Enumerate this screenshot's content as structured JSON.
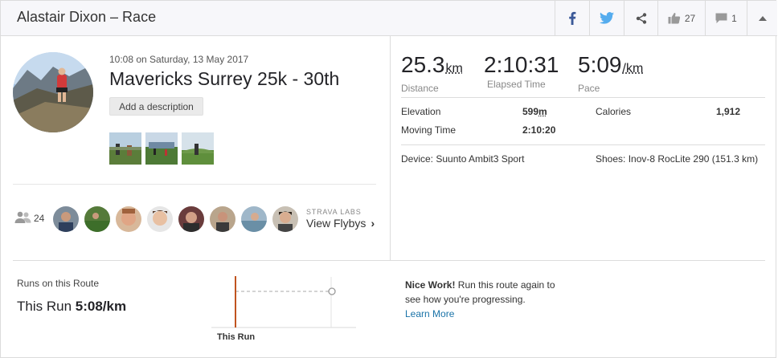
{
  "header": {
    "title": "Alastair Dixon – Race",
    "kudos_count": "27",
    "comments_count": "1"
  },
  "activity": {
    "datetime": "10:08 on Saturday, 13 May 2017",
    "name": "Mavericks Surrey 25k - 30th",
    "add_description": "Add a description"
  },
  "flybys": {
    "athlete_count": "24",
    "labs_label": "STRAVA LABS",
    "link_label": "View Flybys"
  },
  "stats": {
    "distance": {
      "value": "25.3",
      "unit": "km",
      "label": "Distance"
    },
    "elapsed": {
      "value": "2:10:31",
      "label": "Elapsed Time"
    },
    "pace": {
      "value": "5:09",
      "unit": "/km",
      "label": "Pace"
    },
    "elevation": {
      "label": "Elevation",
      "value": "599",
      "unit": "m"
    },
    "moving_time": {
      "label": "Moving Time",
      "value": "2:10:20"
    },
    "calories": {
      "label": "Calories",
      "value": "1,912"
    },
    "device": "Device: Suunto Ambit3 Sport",
    "shoes": "Shoes: Inov-8 RocLite 290 (151.3 km)"
  },
  "route": {
    "title": "Runs on this Route",
    "this_run_label": "This Run",
    "this_run_pace": "5:08/km",
    "chart_label": "This Run",
    "nice_work_bold": "Nice Work!",
    "nice_work_text": " Run this route again to see how you're progressing.",
    "learn_more": "Learn More"
  },
  "colors": {
    "facebook": "#3b5998",
    "twitter": "#55acee",
    "route_bar": "#c0541f",
    "link": "#1a73a8"
  },
  "icons": [
    "facebook-icon",
    "twitter-icon",
    "share-icon",
    "thumbs-up-icon",
    "comment-icon",
    "chevron-up-icon",
    "athletes-icon",
    "chevron-right-icon"
  ]
}
